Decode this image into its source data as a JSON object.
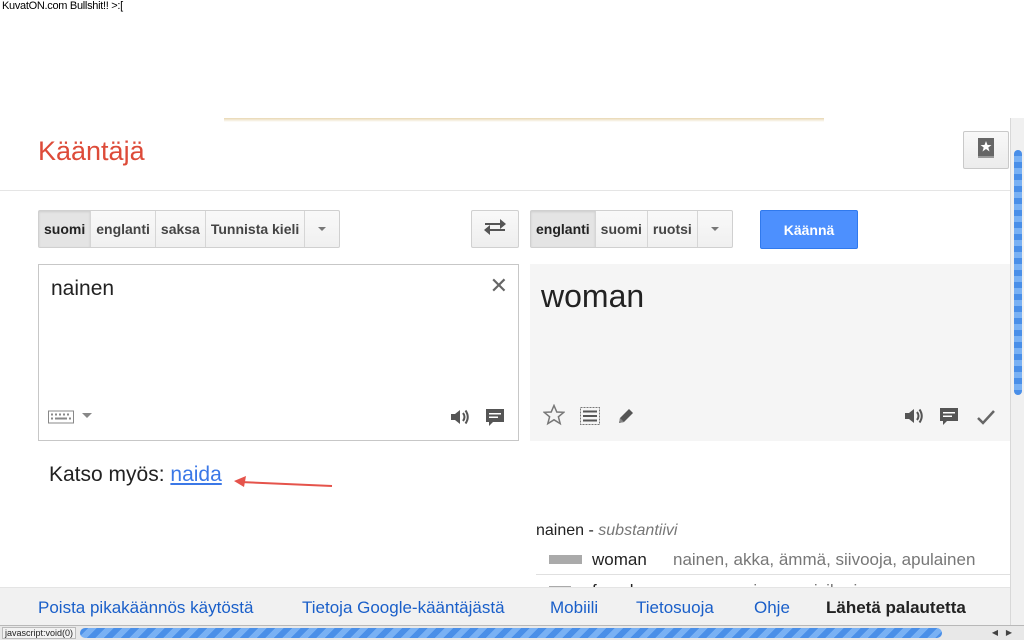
{
  "watermark": "KuvatON.com Bullshit!! >:[",
  "header": {
    "brand": "Kääntäjä"
  },
  "source_langs": [
    {
      "label": "suomi",
      "selected": true
    },
    {
      "label": "englanti",
      "selected": false
    },
    {
      "label": "saksa",
      "selected": false
    },
    {
      "label": "Tunnista kieli",
      "selected": false
    }
  ],
  "target_langs": [
    {
      "label": "englanti",
      "selected": true
    },
    {
      "label": "suomi",
      "selected": false
    },
    {
      "label": "ruotsi",
      "selected": false
    }
  ],
  "translate_button": "Käännä",
  "source": {
    "text": "nainen",
    "clear_icon": "close-icon"
  },
  "result": {
    "text": "woman"
  },
  "see_also": {
    "prefix": "Katso myös:",
    "link": "naida"
  },
  "dictionary": {
    "word": "nainen",
    "separator": "-",
    "pos": "substantiivi",
    "entries": [
      {
        "term": "woman",
        "synonyms": "nainen, akka, ämmä, siivooja, apulainen"
      },
      {
        "term": "female",
        "synonyms": "naaras, nainen, naisihminen"
      }
    ]
  },
  "footer": {
    "links": [
      "Poista pikakäännös käytöstä",
      "Tietoja Google-kääntäjästä",
      "Mobiili",
      "Tietosuoja",
      "Ohje"
    ],
    "feedback": "Lähetä palautetta"
  },
  "status_bar": {
    "text": "javascript:void(0)"
  },
  "colors": {
    "brand": "#dd4b39",
    "primary_button": "#4d90fe",
    "link": "#3b78e7",
    "arrow": "#e5534b"
  }
}
